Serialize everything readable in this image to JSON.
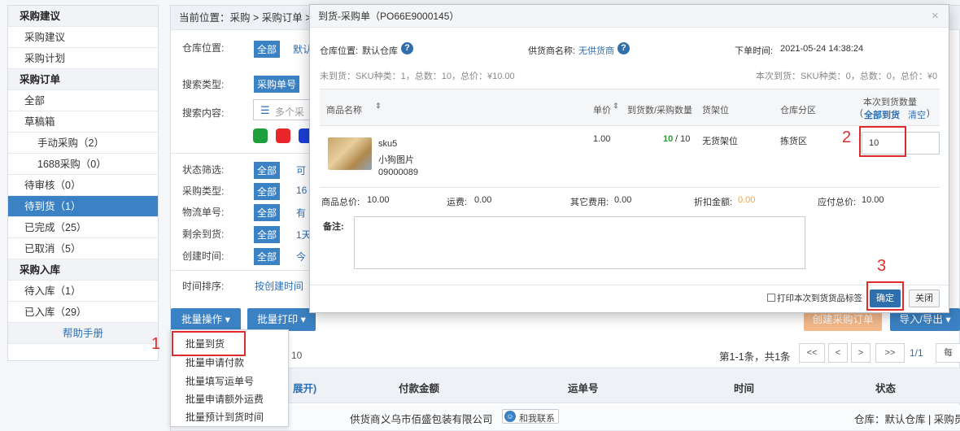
{
  "sidebar": {
    "items": [
      {
        "label": "采购建议",
        "type": "head"
      },
      {
        "label": "采购建议",
        "type": "item"
      },
      {
        "label": "采购计划",
        "type": "item"
      },
      {
        "label": "采购订单",
        "type": "head"
      },
      {
        "label": "全部",
        "type": "item"
      },
      {
        "label": "草稿箱",
        "type": "item"
      },
      {
        "label": "手动采购（2）",
        "type": "sub"
      },
      {
        "label": "1688采购（0）",
        "type": "sub"
      },
      {
        "label": "待审核（0）",
        "type": "item"
      },
      {
        "label": "待到货（1）",
        "type": "active"
      },
      {
        "label": "已完成（25）",
        "type": "item"
      },
      {
        "label": "已取消（5）",
        "type": "item"
      },
      {
        "label": "采购入库",
        "type": "head"
      },
      {
        "label": "待入库（1）",
        "type": "item"
      },
      {
        "label": "已入库（29）",
        "type": "item"
      },
      {
        "label": "帮助手册",
        "type": "help"
      }
    ]
  },
  "breadcrumb": "当前位置：采购 > 采购订单 >",
  "filters": {
    "warehouse_label": "仓库位置:",
    "warehouse_all": "全部",
    "warehouse_default": "默认",
    "search_type_label": "搜索类型:",
    "search_type_value": "采购单号",
    "search_content_label": "搜索内容:",
    "search_content_placeholder": "多个采",
    "status_label": "状态筛选:",
    "status_all": "全部",
    "status_link": "可",
    "ptype_label": "采购类型:",
    "ptype_all": "全部",
    "ptype_link": "16",
    "logistics_label": "物流单号:",
    "logistics_all": "全部",
    "logistics_link": "有",
    "remain_label": "剩余到货:",
    "remain_all": "全部",
    "remain_link": "1天",
    "created_label": "创建时间:",
    "created_all": "全部",
    "created_link": "今",
    "sort_label": "时间排序:",
    "sort_link": "按创建时间",
    "color_swatches": [
      "#1e9e3a",
      "#e8262a",
      "#1b3fd6"
    ]
  },
  "toolbar": {
    "batch_ops": "批量操作 ▾",
    "batch_print": "批量打印 ▾",
    "create_order": "创建采购订单",
    "import_export": "导入/导出 ▾"
  },
  "dropdown": {
    "items": [
      "批量到货",
      "批量申请付款",
      "批量填写运单号",
      "批量申请额外运费",
      "批量预计到货时间"
    ]
  },
  "pagination": {
    "page_size": "10",
    "summary": "第1-1条，共1条",
    "first": "<<",
    "prev": "<",
    "next": ">",
    "last": ">>",
    "current": "1/1",
    "per_page": "每"
  },
  "table": {
    "expand": "展开)",
    "headers": [
      "付款金额",
      "运单号",
      "时间",
      "状态"
    ],
    "supplier_prefix": "供货商：",
    "supplier_name": "义乌市佰盛包装有限公司",
    "contact": "和我联系",
    "warehouse_info": "仓库：默认仓库 | 采购员"
  },
  "modal": {
    "title": "到货-采购单（PO66E9000145）",
    "close": "×",
    "warehouse_label": "仓库位置:",
    "warehouse_value": "默认仓库",
    "supplier_label": "供货商名称:",
    "supplier_value": "无供货商",
    "order_time_label": "下单时间:",
    "order_time_value": "2021-05-24 14:38:24",
    "unarrived_summary": "未到货：SKU种类：1，总数：10，总价：¥10.00",
    "this_arrival_summary": "本次到货：SKU种类：0，总数：0，总价：¥0",
    "columns": {
      "product": "商品名称",
      "price": "单价",
      "arrived": "到货数/采购数量",
      "shelf": "货架位",
      "zone": "仓库分区",
      "qty_this": "本次到货数量",
      "all_arrive": "全部到货",
      "clear": "清空"
    },
    "product": {
      "sku": "sku5",
      "name": "小狗图片",
      "code": "09000089",
      "price": "1.00",
      "arrived": "10",
      "ordered": "/ 10",
      "shelf": "无货架位",
      "zone": "拣货区",
      "qty": "10"
    },
    "totals": {
      "goods_label": "商品总价:",
      "goods_value": "10.00",
      "freight_label": "运费:",
      "freight_value": "0.00",
      "other_label": "其它费用:",
      "other_value": "0.00",
      "discount_label": "折扣金额:",
      "discount_value": "0.00",
      "payable_label": "应付总价:",
      "payable_value": "10.00"
    },
    "remark_label": "备注:",
    "print_label": "打印本次到货货品标签",
    "confirm": "确定",
    "cancel": "关闭"
  },
  "annotations": [
    "1",
    "2",
    "3"
  ],
  "colors": {
    "accent": "#3b82c4",
    "green": "#2e9a3a",
    "orange": "#f0a13c",
    "annotation_red": "#e02b2b"
  }
}
